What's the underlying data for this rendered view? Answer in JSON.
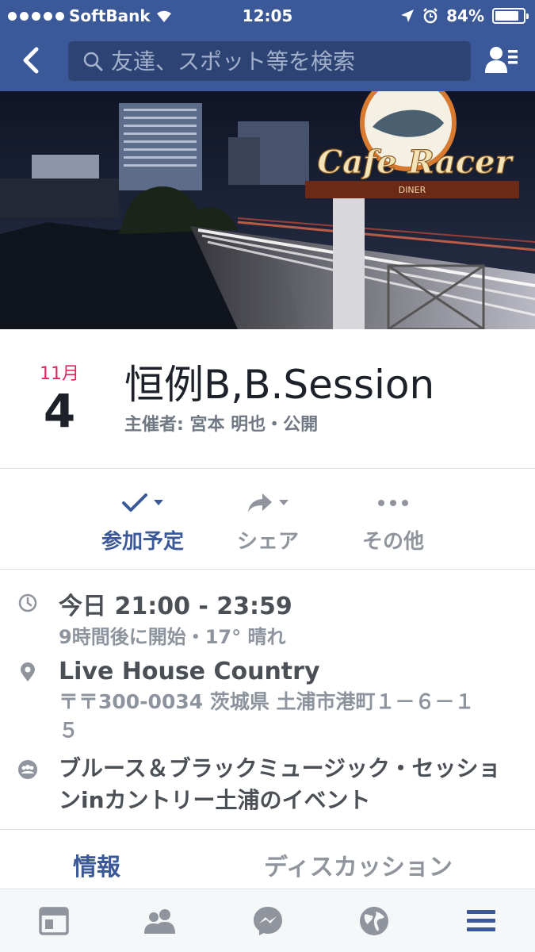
{
  "status_bar": {
    "carrier": "SoftBank",
    "time": "12:05",
    "battery": "84%",
    "battery_level": 0.84
  },
  "nav": {
    "search_placeholder": "友達、スポット等を検索",
    "icons": [
      "back-icon",
      "search-icon",
      "friend-requests-icon"
    ]
  },
  "cover": {
    "sign_text": "Cafe Racer",
    "sign_sub": "DINER"
  },
  "event": {
    "month": "11月",
    "day": "4",
    "title": "恒例B,B.Session",
    "host_line": "主催者: 宮本 明也・公開"
  },
  "actions": [
    {
      "label": "参加予定",
      "icon": "checkmark-icon"
    },
    {
      "label": "シェア",
      "icon": "share-arrow-icon"
    },
    {
      "label": "その他",
      "icon": "more-dots-icon"
    }
  ],
  "details": {
    "time_main": "今日 21:00 - 23:59",
    "time_sub": "9時間後に開始・17° 晴れ",
    "place_name": "Live House Country",
    "place_address": "〒〒300-0034 茨城県 土浦市港町１－６－１５",
    "group_text": "ブルース＆ブラックミュージック・セッションinカントリー土浦のイベント"
  },
  "tabs": {
    "info": "情報",
    "discussion": "ディスカッション"
  },
  "accent_color": "#3b5998",
  "date_color": "#e0245e"
}
